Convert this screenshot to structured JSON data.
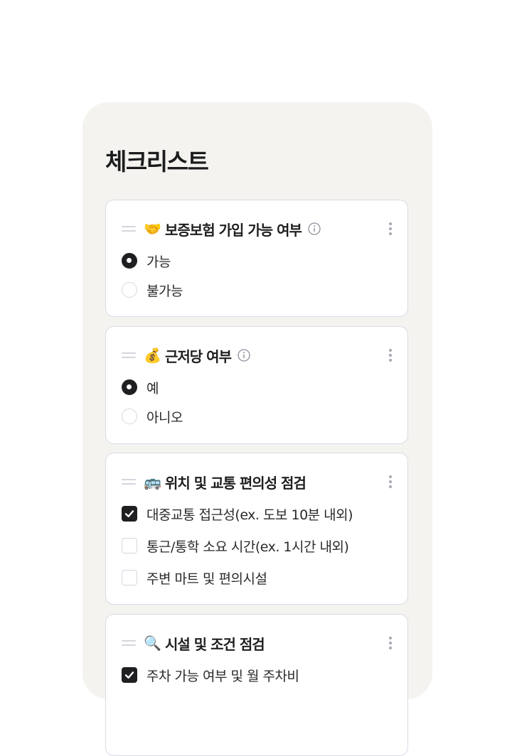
{
  "title": "체크리스트",
  "cards": [
    {
      "emoji": "🤝",
      "title": "보증보험 가입 가능 여부",
      "options": [
        {
          "label": "가능",
          "checked": true
        },
        {
          "label": "불가능",
          "checked": false
        }
      ]
    },
    {
      "emoji": "💰",
      "title": "근저당 여부",
      "options": [
        {
          "label": "예",
          "checked": true
        },
        {
          "label": "아니오",
          "checked": false
        }
      ]
    },
    {
      "emoji": "🚌",
      "title": "위치 및 교통 편의성 점검",
      "options": [
        {
          "label": "대중교통 접근성(ex. 도보 10분 내외)",
          "checked": true
        },
        {
          "label": "통근/통학 소요 시간(ex. 1시간 내외)",
          "checked": false
        },
        {
          "label": "주변 마트 및 편의시설",
          "checked": false
        }
      ]
    },
    {
      "emoji": "🔍",
      "title": "시설 및 조건 점검",
      "options": [
        {
          "label": "주차 가능 여부 및 월 주차비",
          "checked": true
        }
      ]
    }
  ],
  "icons": {
    "drag": "drag-handle-icon",
    "info": "info-icon",
    "more": "more-vertical-icon",
    "check": "check-icon"
  }
}
